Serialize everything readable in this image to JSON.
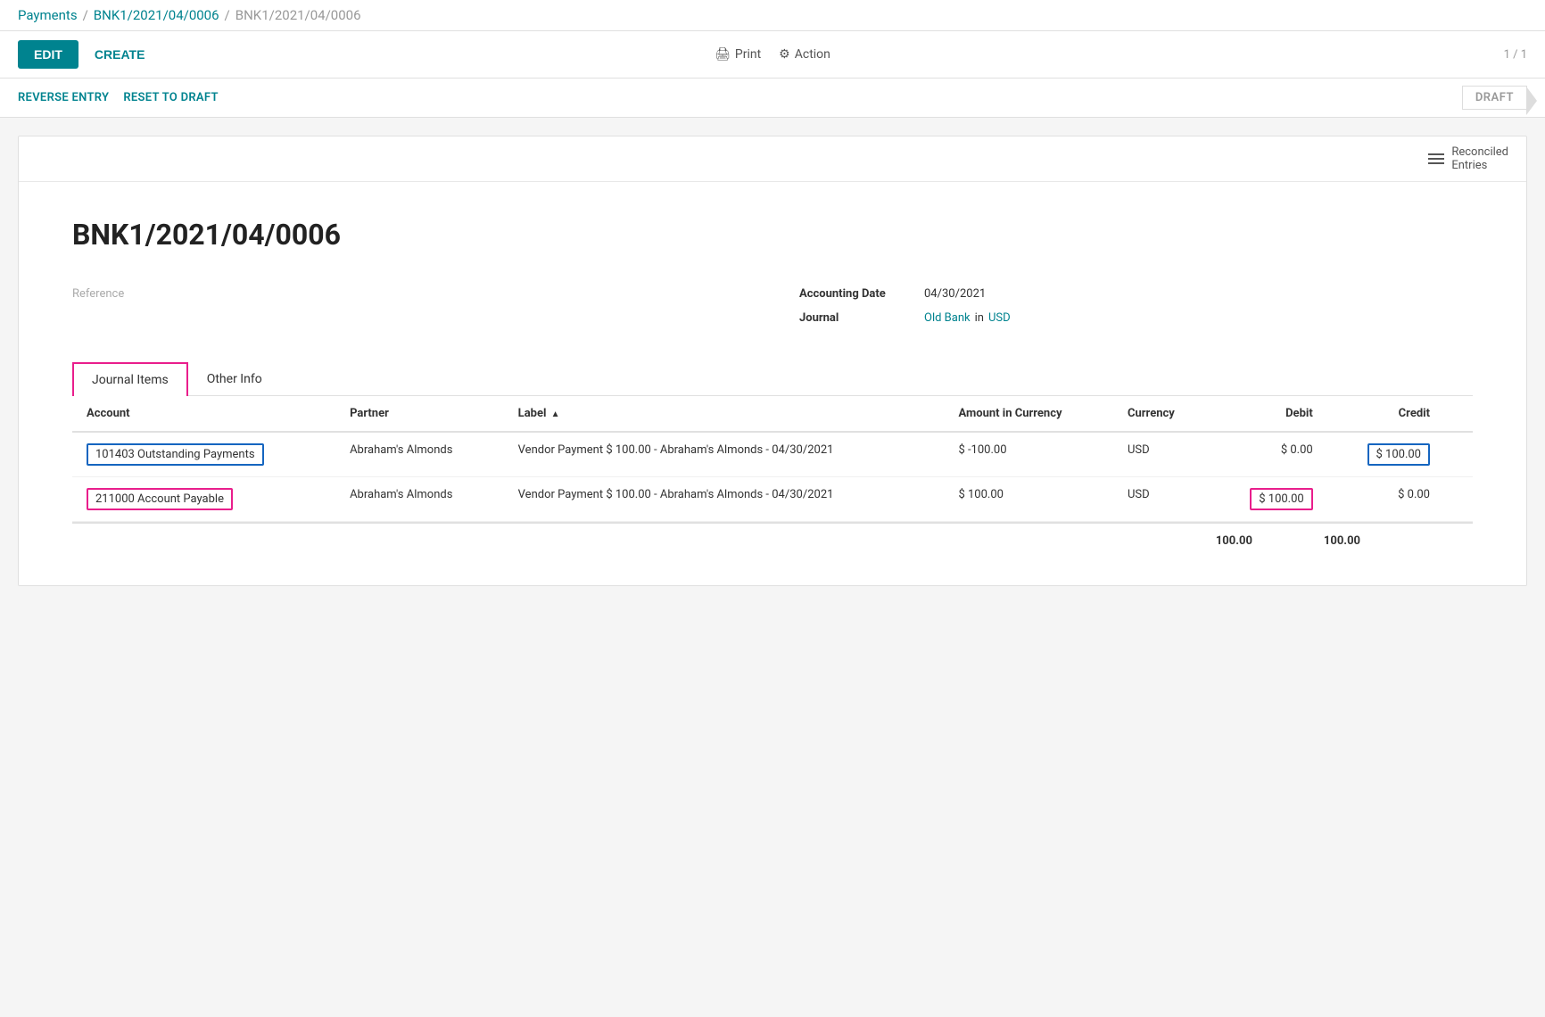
{
  "breadcrumb": {
    "payments": "Payments",
    "sep1": "/",
    "ref1": "BNK1/2021/04/0006",
    "sep2": "/",
    "current": "BNK1/2021/04/0006"
  },
  "toolbar": {
    "edit_label": "EDIT",
    "create_label": "CREATE",
    "print_label": "Print",
    "action_label": "Action",
    "page_indicator": "1 / 1"
  },
  "action_bar": {
    "reverse_entry": "REVERSE ENTRY",
    "reset_to_draft": "RESET TO DRAFT",
    "status": "DRAFT"
  },
  "reconciled_entries": {
    "label": "Reconciled\nEntries"
  },
  "form": {
    "title": "BNK1/2021/04/0006",
    "reference_label": "Reference",
    "reference_value": "",
    "accounting_date_label": "Accounting Date",
    "accounting_date_value": "04/30/2021",
    "journal_label": "Journal",
    "journal_bank": "Old Bank",
    "journal_in": "in",
    "journal_currency": "USD"
  },
  "tabs": [
    {
      "id": "journal-items",
      "label": "Journal Items",
      "active": true
    },
    {
      "id": "other-info",
      "label": "Other Info",
      "active": false
    }
  ],
  "table": {
    "columns": [
      {
        "id": "account",
        "label": "Account"
      },
      {
        "id": "partner",
        "label": "Partner"
      },
      {
        "id": "label",
        "label": "Label",
        "sortable": true,
        "sort": "asc"
      },
      {
        "id": "amount_currency",
        "label": "Amount in Currency"
      },
      {
        "id": "currency",
        "label": "Currency"
      },
      {
        "id": "debit",
        "label": "Debit",
        "align": "right"
      },
      {
        "id": "credit",
        "label": "Credit",
        "align": "right"
      }
    ],
    "rows": [
      {
        "account": "101403 Outstanding Payments",
        "account_style": "blue",
        "partner": "Abraham's Almonds",
        "label": "Vendor Payment $ 100.00 - Abraham's Almonds - 04/30/2021",
        "amount_currency": "$ -100.00",
        "currency": "USD",
        "debit": "$ 0.00",
        "credit": "$ 100.00",
        "credit_style": "blue"
      },
      {
        "account": "211000 Account Payable",
        "account_style": "red",
        "partner": "Abraham's Almonds",
        "label": "Vendor Payment $ 100.00 - Abraham's Almonds - 04/30/2021",
        "amount_currency": "$ 100.00",
        "currency": "USD",
        "debit": "$ 100.00",
        "debit_style": "red",
        "credit": "$ 0.00"
      }
    ],
    "footer": {
      "debit_total": "100.00",
      "credit_total": "100.00"
    }
  }
}
